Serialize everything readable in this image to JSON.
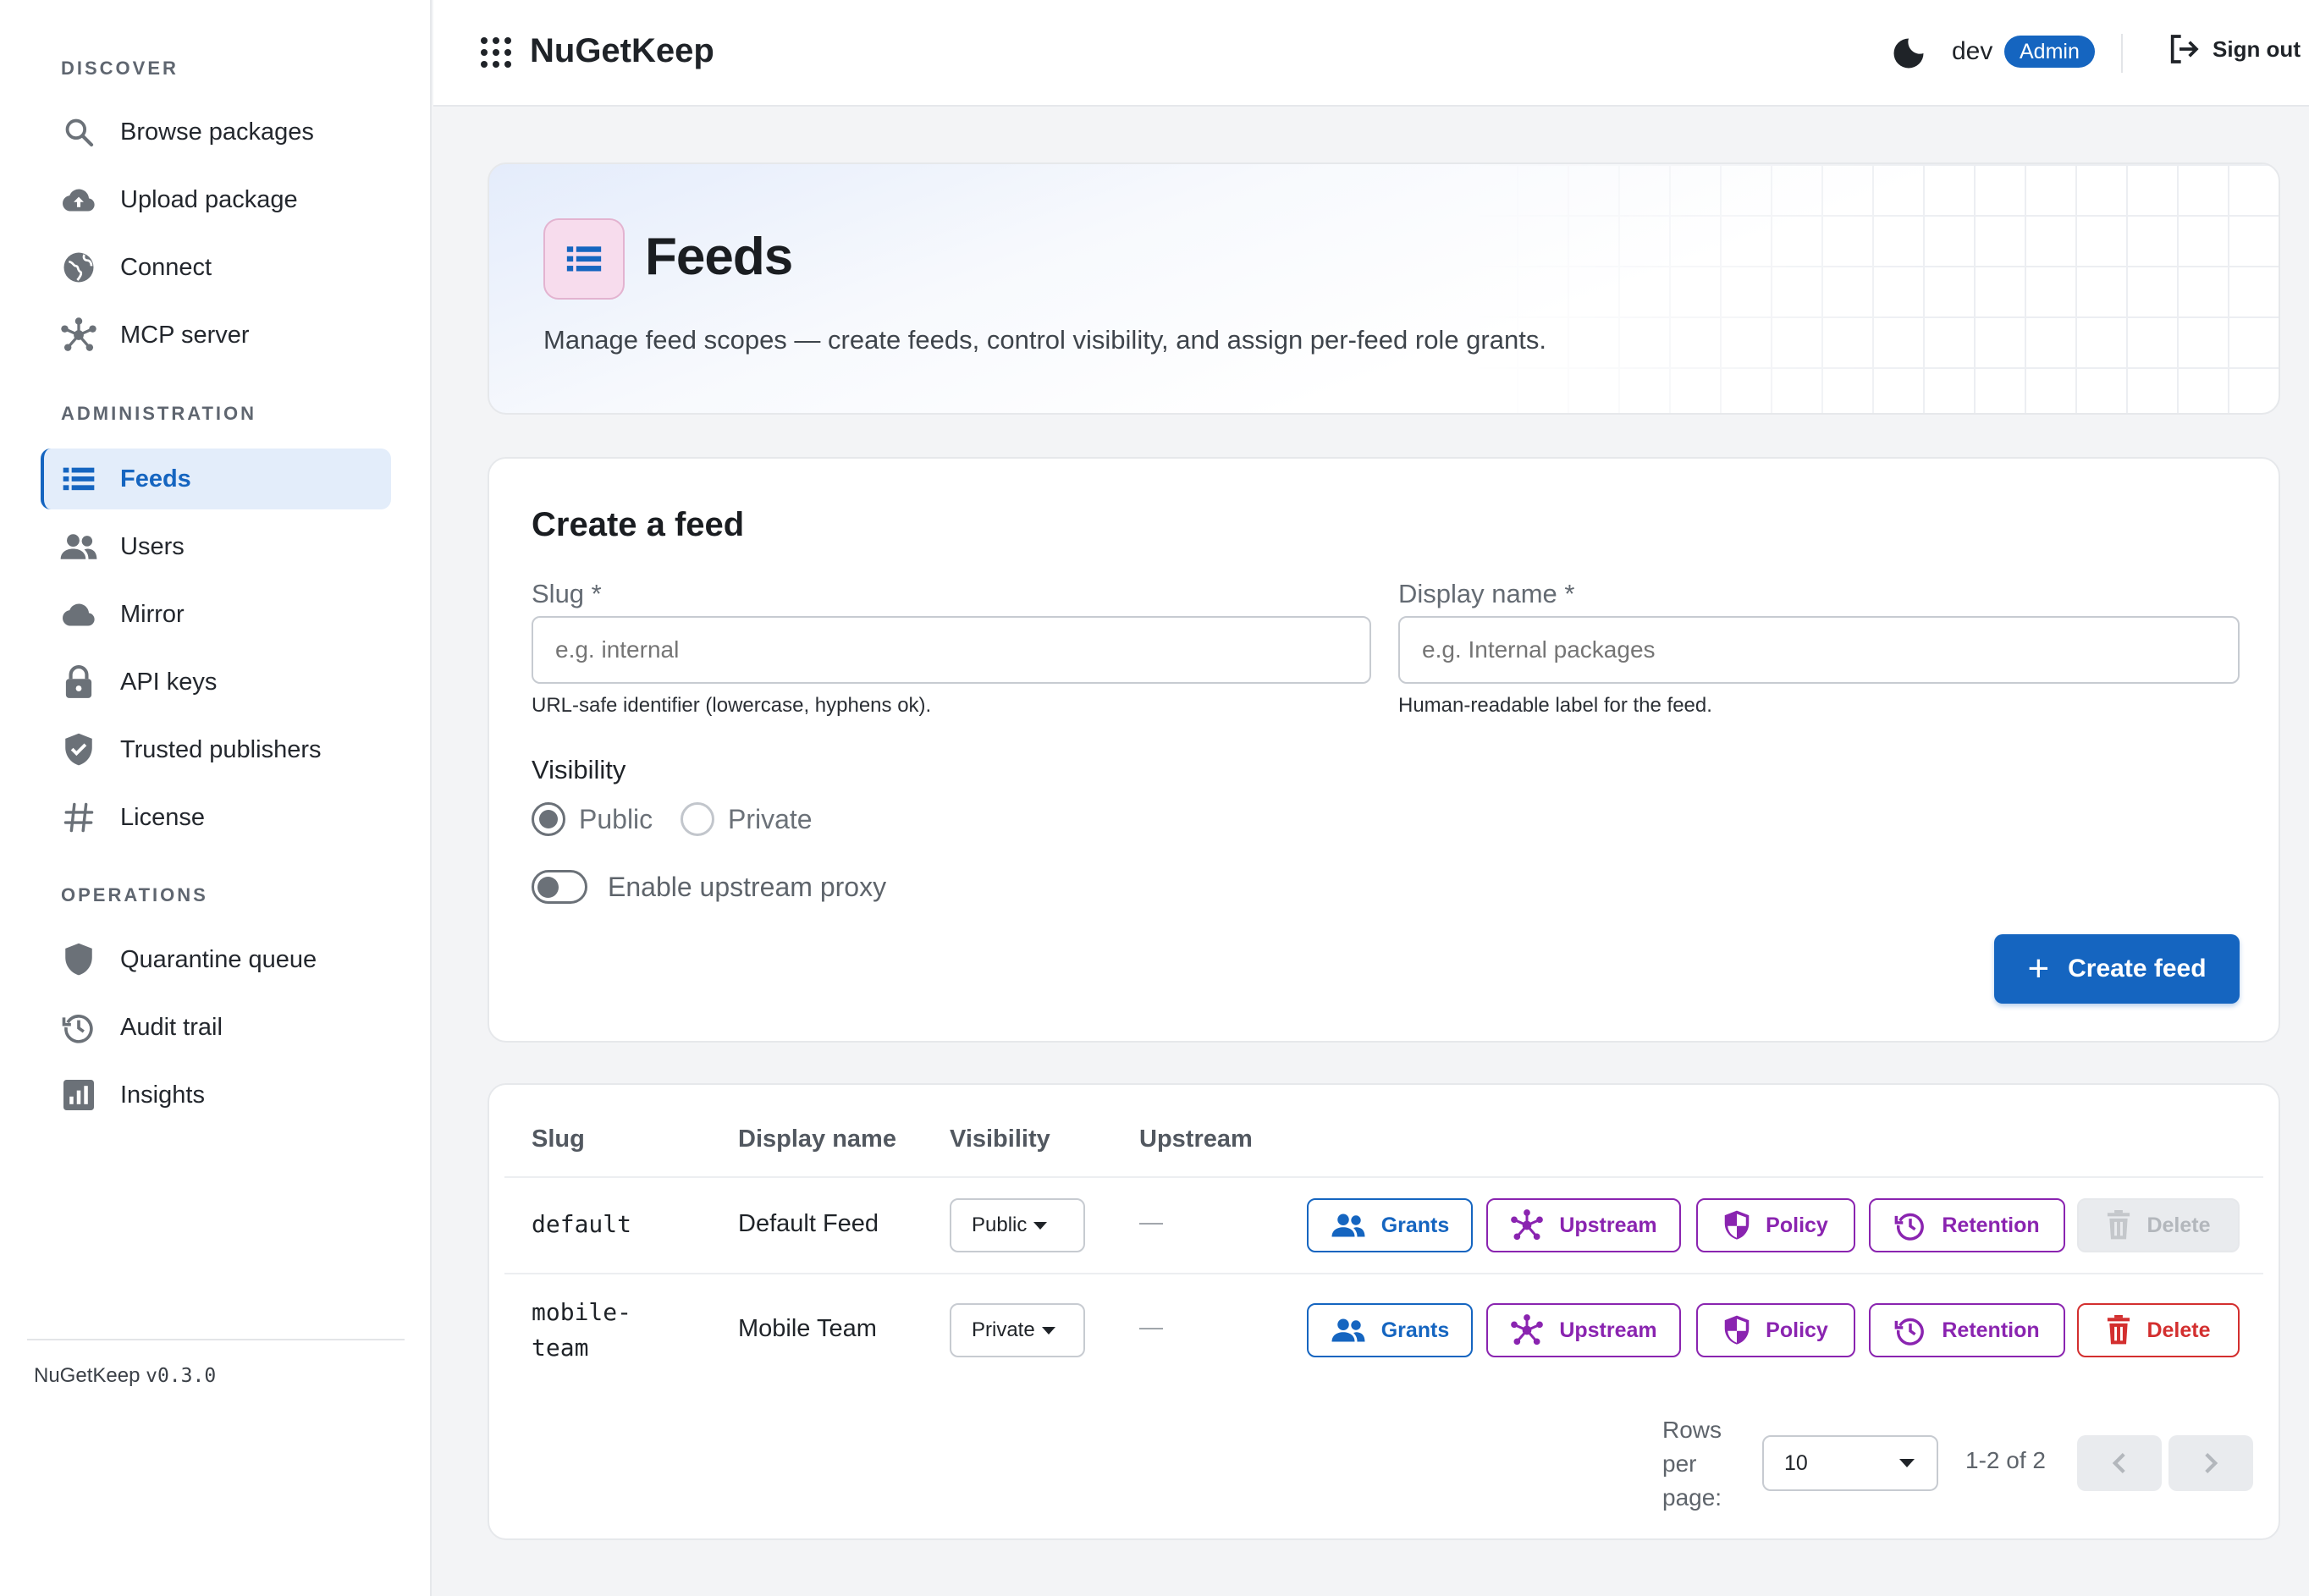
{
  "app": {
    "name": "NuGetKeep",
    "version_prefix": "NuGetKeep ",
    "version": "v0.3.0"
  },
  "sidebar": {
    "sections": [
      {
        "heading": "DISCOVER",
        "items": [
          {
            "label": "Browse packages",
            "icon": "search-icon"
          },
          {
            "label": "Upload package",
            "icon": "cloud-upload-icon"
          },
          {
            "label": "Connect",
            "icon": "globe-icon"
          },
          {
            "label": "MCP server",
            "icon": "hub-icon"
          }
        ]
      },
      {
        "heading": "ADMINISTRATION",
        "items": [
          {
            "label": "Feeds",
            "icon": "list-icon",
            "active": true
          },
          {
            "label": "Users",
            "icon": "users-icon"
          },
          {
            "label": "Mirror",
            "icon": "cloud-icon"
          },
          {
            "label": "API keys",
            "icon": "lock-icon"
          },
          {
            "label": "Trusted publishers",
            "icon": "shield-check-icon"
          },
          {
            "label": "License",
            "icon": "hash-icon"
          }
        ]
      },
      {
        "heading": "OPERATIONS",
        "items": [
          {
            "label": "Quarantine queue",
            "icon": "shield-icon"
          },
          {
            "label": "Audit trail",
            "icon": "history-icon"
          },
          {
            "label": "Insights",
            "icon": "bar-chart-icon"
          }
        ]
      }
    ]
  },
  "topbar": {
    "title": "NuGetKeep",
    "user": "dev",
    "role": "Admin",
    "signout": "Sign out"
  },
  "hero": {
    "title": "Feeds",
    "subtitle": "Manage feed scopes — create feeds, control visibility, and assign per-feed role grants."
  },
  "create_form": {
    "title": "Create a feed",
    "slug": {
      "label": "Slug *",
      "placeholder": "e.g. internal",
      "value": "",
      "helper": "URL-safe identifier (lowercase, hyphens ok)."
    },
    "display_name": {
      "label": "Display name *",
      "placeholder": "e.g. Internal packages",
      "value": "",
      "helper": "Human-readable label for the feed."
    },
    "visibility": {
      "label": "Visibility",
      "options": [
        "Public",
        "Private"
      ],
      "selected": "Public"
    },
    "upstream_toggle": {
      "label": "Enable upstream proxy",
      "on": false
    },
    "submit": "Create feed"
  },
  "table": {
    "headers": {
      "slug": "Slug",
      "display_name": "Display name",
      "visibility": "Visibility",
      "upstream": "Upstream"
    },
    "rows": [
      {
        "slug": "default",
        "display_name": "Default Feed",
        "visibility": "Public",
        "upstream": "—",
        "delete_enabled": false
      },
      {
        "slug_line1": "mobile-",
        "slug_line2": "team",
        "display_name": "Mobile Team",
        "visibility": "Private",
        "upstream": "—",
        "delete_enabled": true
      }
    ],
    "actions": {
      "grants": "Grants",
      "upstream": "Upstream",
      "policy": "Policy",
      "retention": "Retention",
      "delete": "Delete"
    },
    "pagination": {
      "rows_label_1": "Rows",
      "rows_label_2": "per",
      "rows_label_3": "page:",
      "rows_per_page": "10",
      "range": "1-2 of 2"
    }
  },
  "colors": {
    "primary": "#1565c0",
    "purple": "#8a24b0",
    "danger": "#d32f2f",
    "active_nav_bg": "#e3edfa"
  }
}
